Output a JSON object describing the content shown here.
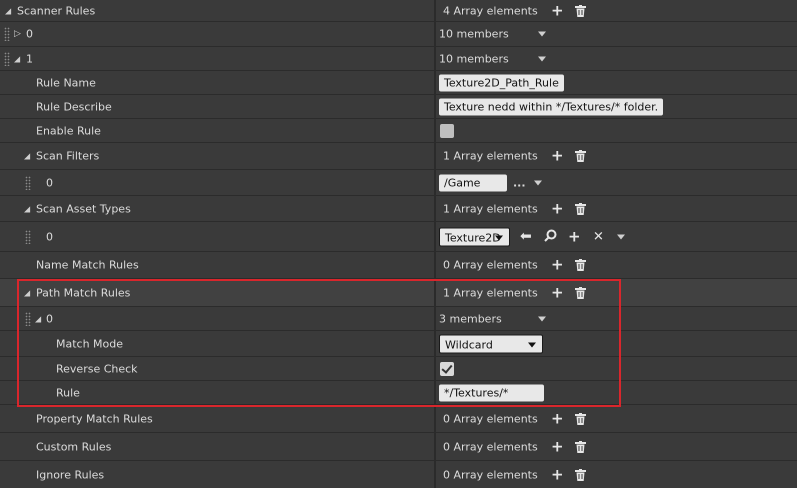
{
  "scanner_rules": {
    "label": "Scanner Rules",
    "count": "4 Array elements",
    "items": [
      {
        "index": "0",
        "members": "10 members"
      },
      {
        "index": "1",
        "members": "10 members"
      }
    ]
  },
  "rule": {
    "name_label": "Rule Name",
    "name_value": "Texture2D_Path_Rule",
    "describe_label": "Rule Describe",
    "describe_value": "Texture nedd within */Textures/* folder.",
    "enable_label": "Enable Rule",
    "enable_checked": false
  },
  "scan_filters": {
    "label": "Scan Filters",
    "count": "1 Array elements",
    "item_index": "0",
    "item_value": "/Game",
    "ellipsis": "..."
  },
  "scan_asset_types": {
    "label": "Scan Asset Types",
    "count": "1 Array elements",
    "item_index": "0",
    "item_value": "Texture2D"
  },
  "name_match_rules": {
    "label": "Name Match Rules",
    "count": "0 Array elements"
  },
  "path_match_rules": {
    "label": "Path Match Rules",
    "count": "1 Array elements",
    "item_index": "0",
    "item_members": "3 members",
    "match_mode_label": "Match Mode",
    "match_mode_value": "Wildcard",
    "reverse_check_label": "Reverse Check",
    "reverse_check_checked": true,
    "rule_label": "Rule",
    "rule_value": "*/Textures/*"
  },
  "property_match_rules": {
    "label": "Property Match Rules",
    "count": "0 Array elements"
  },
  "custom_rules": {
    "label": "Custom Rules",
    "count": "0 Array elements"
  },
  "ignore_rules": {
    "label": "Ignore Rules",
    "count": "0 Array elements"
  },
  "colors": {
    "background": "#3a3a3a",
    "highlight_row": "#414141",
    "annotation_box": "#d9262c"
  }
}
